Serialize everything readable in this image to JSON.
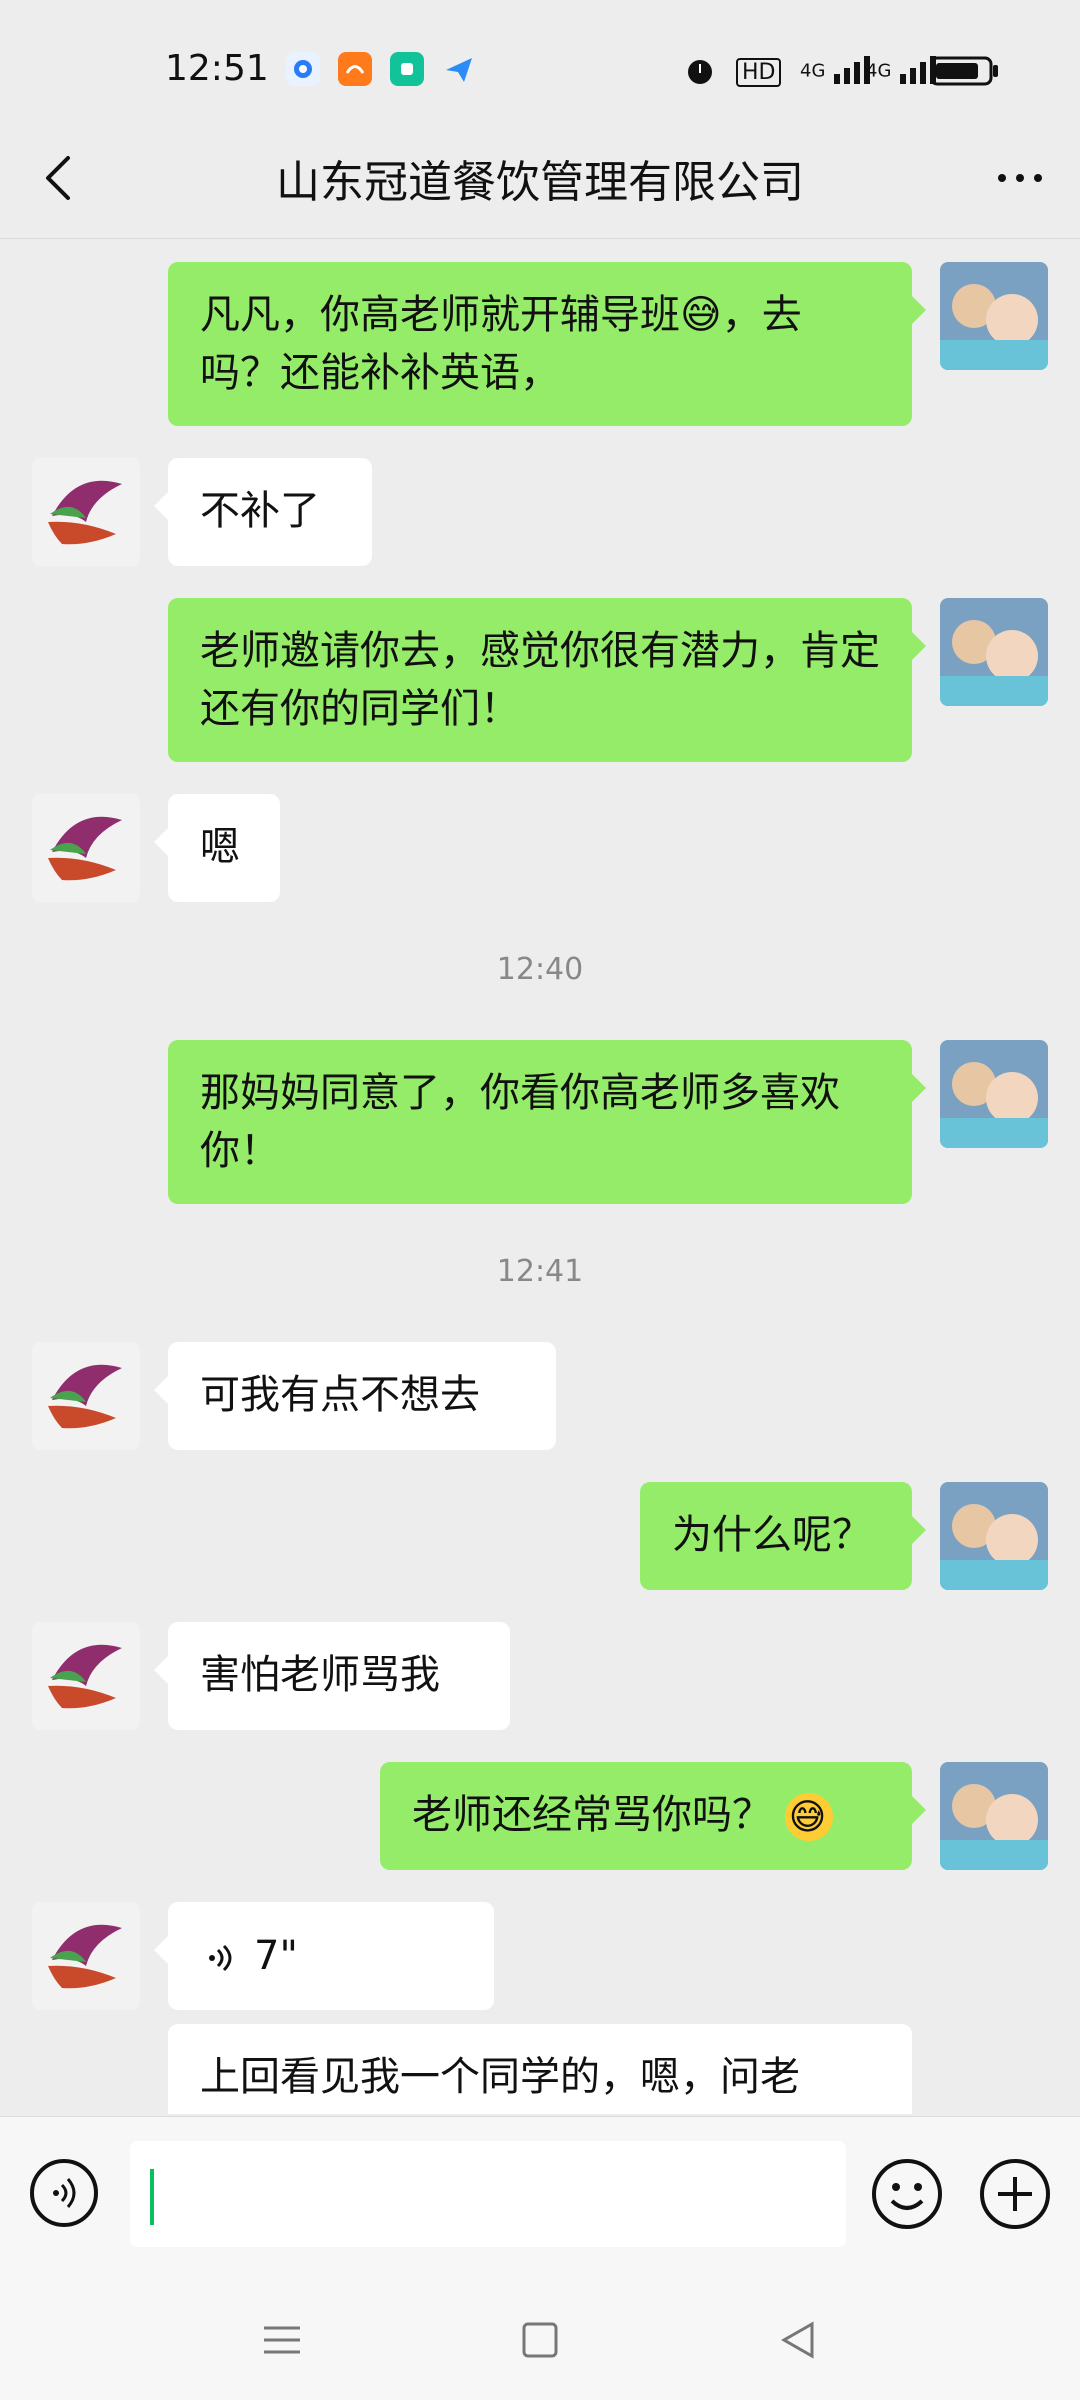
{
  "status_bar": {
    "time": "12:51",
    "net1": "4G",
    "net2": "4G",
    "hd": "HD",
    "icons": [
      "chat-bubble-icon",
      "uc-browser-icon",
      "app-green-icon",
      "send-icon",
      "alarm-icon",
      "battery-icon"
    ]
  },
  "header": {
    "title": "山东冠道餐饮管理有限公司"
  },
  "messages": [
    {
      "side": "right",
      "text": "凡凡，你高老师就开辅导班😅，去吗？还能补补英语，"
    },
    {
      "side": "left",
      "text": "不补了"
    },
    {
      "side": "right",
      "text": "老师邀请你去，感觉你很有潜力，肯定还有你的同学们！"
    },
    {
      "side": "left",
      "text": "嗯"
    },
    {
      "type": "timestamp",
      "text": "12:40"
    },
    {
      "side": "right",
      "text": "那妈妈同意了，你看你高老师多喜欢你！"
    },
    {
      "type": "timestamp",
      "text": "12:41"
    },
    {
      "side": "left",
      "text": "可我有点不想去"
    },
    {
      "side": "right",
      "text": "为什么呢？"
    },
    {
      "side": "left",
      "text": "害怕老师骂我"
    },
    {
      "side": "right",
      "text": "老师还经常骂你吗？"
    },
    {
      "side": "left",
      "type": "voice",
      "duration": "7\""
    },
    {
      "side": "left",
      "text": "上回看见我一个同学的，嗯，问老"
    }
  ],
  "input": {
    "placeholder": ""
  }
}
